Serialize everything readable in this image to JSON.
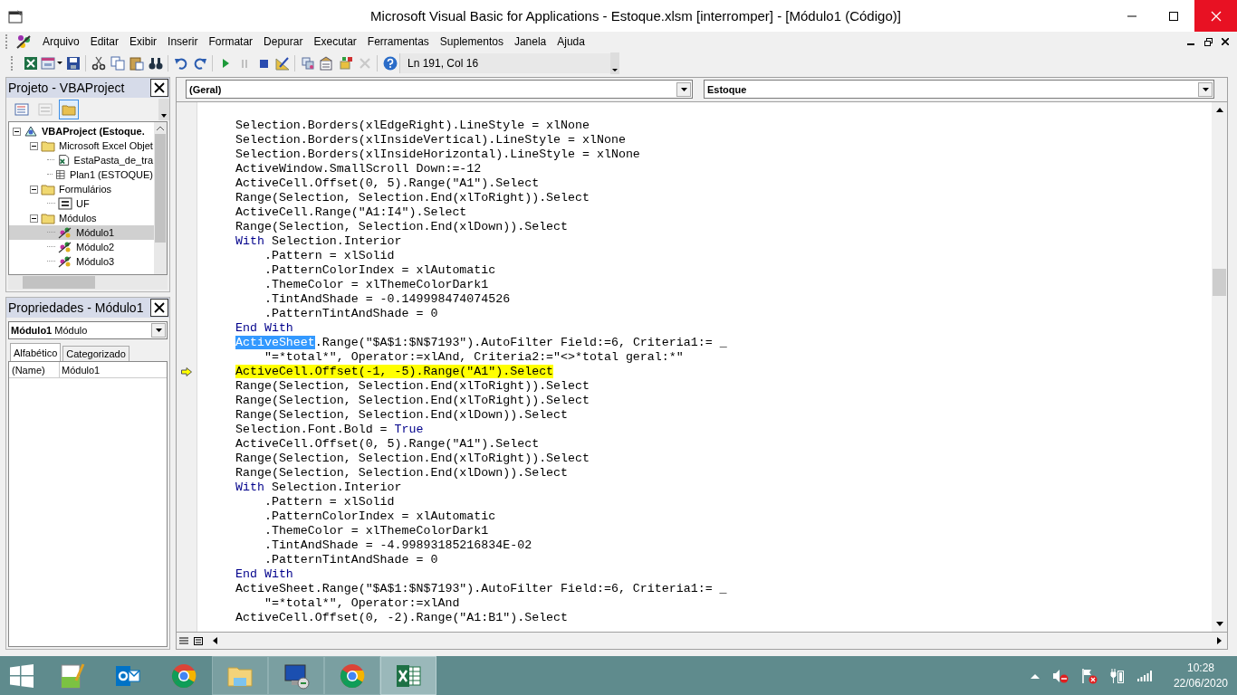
{
  "window": {
    "title": "Microsoft Visual Basic for Applications - Estoque.xlsm [interromper] - [Módulo1 (Código)]"
  },
  "menu": [
    "Arquivo",
    "Editar",
    "Exibir",
    "Inserir",
    "Formatar",
    "Depurar",
    "Executar",
    "Ferramentas",
    "Suplementos",
    "Janela",
    "Ajuda"
  ],
  "toolbar": {
    "buttons": [
      {
        "kind": "excel",
        "disabled": false
      },
      {
        "kind": "insert-form",
        "disabled": false
      },
      {
        "kind": "save",
        "disabled": false
      },
      {
        "kind": "cut",
        "disabled": false
      },
      {
        "kind": "copy",
        "disabled": false
      },
      {
        "kind": "paste",
        "disabled": false
      },
      {
        "kind": "find",
        "disabled": false
      },
      {
        "kind": "undo",
        "disabled": false
      },
      {
        "kind": "redo",
        "disabled": false
      },
      {
        "kind": "run",
        "disabled": false
      },
      {
        "kind": "pause",
        "disabled": true
      },
      {
        "kind": "stop",
        "disabled": false
      },
      {
        "kind": "design",
        "disabled": false
      },
      {
        "kind": "project",
        "disabled": false
      },
      {
        "kind": "properties",
        "disabled": false
      },
      {
        "kind": "browser",
        "disabled": false
      },
      {
        "kind": "toolbox",
        "disabled": true
      },
      {
        "kind": "help",
        "disabled": false
      }
    ],
    "position": "Ln 191, Col 16"
  },
  "project": {
    "title": "Projeto - VBAProject",
    "buttons": [
      {
        "kind": "view-code",
        "disabled": false,
        "selected": false
      },
      {
        "kind": "view-object",
        "disabled": true,
        "selected": false
      },
      {
        "kind": "folders",
        "disabled": false,
        "selected": true
      }
    ],
    "tree": [
      {
        "label": "VBAProject (Estoque.",
        "kind": "project",
        "expanded": true,
        "selected": false,
        "children": [
          {
            "label": "Microsoft Excel Objet",
            "kind": "folder",
            "expanded": true,
            "selected": false,
            "children": [
              {
                "label": "EstaPasta_de_tra",
                "kind": "workbook",
                "selected": false
              },
              {
                "label": "Plan1 (ESTOQUE)",
                "kind": "sheet",
                "selected": false
              }
            ]
          },
          {
            "label": "Formulários",
            "kind": "folder",
            "expanded": true,
            "selected": false,
            "children": [
              {
                "label": "UF",
                "kind": "form",
                "selected": false
              }
            ]
          },
          {
            "label": "Módulos",
            "kind": "folder",
            "expanded": true,
            "selected": false,
            "children": [
              {
                "label": "Módulo1",
                "kind": "module",
                "selected": true
              },
              {
                "label": "Módulo2",
                "kind": "module",
                "selected": false
              },
              {
                "label": "Módulo3",
                "kind": "module",
                "selected": false
              }
            ]
          }
        ]
      }
    ]
  },
  "properties": {
    "title": "Propriedades - Módulo1",
    "object_name": "Módulo1",
    "object_type": "Módulo",
    "tabs": [
      {
        "label": "Alfabético",
        "selected": true
      },
      {
        "label": "Categorizado",
        "selected": false
      }
    ],
    "rows": [
      {
        "name": "(Name)",
        "value": "Módulo1"
      }
    ]
  },
  "code": {
    "object": "(Geral)",
    "procedure": "Estoque",
    "lines": [
      {
        "current": false,
        "segments": [
          {
            "text": "Selection.Borders(xlEdgeRight).LineStyle = xlNone",
            "kind": "plain"
          }
        ]
      },
      {
        "current": false,
        "segments": [
          {
            "text": "Selection.Borders(xlInsideVertical).LineStyle = xlNone",
            "kind": "plain"
          }
        ]
      },
      {
        "current": false,
        "segments": [
          {
            "text": "Selection.Borders(xlInsideHorizontal).LineStyle = xlNone",
            "kind": "plain"
          }
        ]
      },
      {
        "current": false,
        "segments": [
          {
            "text": "ActiveWindow.SmallScroll Down:=-12",
            "kind": "plain"
          }
        ]
      },
      {
        "current": false,
        "segments": [
          {
            "text": "ActiveCell.Offset(0, 5).Range(\"A1\").Select",
            "kind": "plain"
          }
        ]
      },
      {
        "current": false,
        "segments": [
          {
            "text": "Range(Selection, Selection.End(xlToRight)).Select",
            "kind": "plain"
          }
        ]
      },
      {
        "current": false,
        "segments": [
          {
            "text": "ActiveCell.Range(\"A1:I4\").Select",
            "kind": "plain"
          }
        ]
      },
      {
        "current": false,
        "segments": [
          {
            "text": "Range(Selection, Selection.End(xlDown)).Select",
            "kind": "plain"
          }
        ]
      },
      {
        "current": false,
        "segments": [
          {
            "text": "With",
            "kind": "keyword"
          },
          {
            "text": "Selection.Interior",
            "kind": "plain"
          }
        ]
      },
      {
        "current": false,
        "segments": [
          {
            "text": "    .Pattern = xlSolid",
            "kind": "plain"
          }
        ]
      },
      {
        "current": false,
        "segments": [
          {
            "text": "    .PatternColorIndex = xlAutomatic",
            "kind": "plain"
          }
        ]
      },
      {
        "current": false,
        "segments": [
          {
            "text": "    .ThemeColor = xlThemeColorDark1",
            "kind": "plain"
          }
        ]
      },
      {
        "current": false,
        "segments": [
          {
            "text": "    .TintAndShade = -0.149998474074526",
            "kind": "plain"
          }
        ]
      },
      {
        "current": false,
        "segments": [
          {
            "text": "    .PatternTintAndShade = 0",
            "kind": "plain"
          }
        ]
      },
      {
        "current": false,
        "segments": [
          {
            "text": "End With",
            "kind": "keyword"
          }
        ]
      },
      {
        "current": false,
        "segments": [
          {
            "text": "ActiveSheet",
            "kind": "selected"
          },
          {
            "text": ".Range(\"$A$1:$N$7193\").AutoFilter Field:=6, Criteria1:= _",
            "kind": "plain"
          }
        ]
      },
      {
        "current": false,
        "segments": [
          {
            "text": "    \"=*total*\", Operator:=xlAnd, Criteria2:=\"<>*total geral:*\"",
            "kind": "plain"
          }
        ]
      },
      {
        "current": true,
        "segments": [
          {
            "text": "ActiveCell.Offset(-1, -5).Range(\"A1\").Select",
            "kind": "plain"
          }
        ]
      },
      {
        "current": false,
        "segments": [
          {
            "text": "Range(Selection, Selection.End(xlToRight)).Select",
            "kind": "plain"
          }
        ]
      },
      {
        "current": false,
        "segments": [
          {
            "text": "Range(Selection, Selection.End(xlToRight)).Select",
            "kind": "plain"
          }
        ]
      },
      {
        "current": false,
        "segments": [
          {
            "text": "Range(Selection, Selection.End(xlDown)).Select",
            "kind": "plain"
          }
        ]
      },
      {
        "current": false,
        "segments": [
          {
            "text": "Selection.Font.Bold =",
            "kind": "plain"
          },
          {
            "text": "True",
            "kind": "keyword"
          }
        ]
      },
      {
        "current": false,
        "segments": [
          {
            "text": "ActiveCell.Offset(0, 5).Range(\"A1\").Select",
            "kind": "plain"
          }
        ]
      },
      {
        "current": false,
        "segments": [
          {
            "text": "Range(Selection, Selection.End(xlToRight)).Select",
            "kind": "plain"
          }
        ]
      },
      {
        "current": false,
        "segments": [
          {
            "text": "Range(Selection, Selection.End(xlDown)).Select",
            "kind": "plain"
          }
        ]
      },
      {
        "current": false,
        "segments": [
          {
            "text": "With",
            "kind": "keyword"
          },
          {
            "text": "Selection.Interior",
            "kind": "plain"
          }
        ]
      },
      {
        "current": false,
        "segments": [
          {
            "text": "    .Pattern = xlSolid",
            "kind": "plain"
          }
        ]
      },
      {
        "current": false,
        "segments": [
          {
            "text": "    .PatternColorIndex = xlAutomatic",
            "kind": "plain"
          }
        ]
      },
      {
        "current": false,
        "segments": [
          {
            "text": "    .ThemeColor = xlThemeColorDark1",
            "kind": "plain"
          }
        ]
      },
      {
        "current": false,
        "segments": [
          {
            "text": "    .TintAndShade = -4.99893185216834E-02",
            "kind": "plain"
          }
        ]
      },
      {
        "current": false,
        "segments": [
          {
            "text": "    .PatternTintAndShade = 0",
            "kind": "plain"
          }
        ]
      },
      {
        "current": false,
        "segments": [
          {
            "text": "End With",
            "kind": "keyword"
          }
        ]
      },
      {
        "current": false,
        "segments": [
          {
            "text": "ActiveSheet.Range(\"$A$1:$N$7193\").AutoFilter Field:=6, Criteria1:= _",
            "kind": "plain"
          }
        ]
      },
      {
        "current": false,
        "segments": [
          {
            "text": "    \"=*total*\", Operator:=xlAnd",
            "kind": "plain"
          }
        ]
      },
      {
        "current": false,
        "segments": [
          {
            "text": "ActiveCell.Offset(0, -2).Range(\"A1:B1\").Select",
            "kind": "plain"
          }
        ]
      }
    ]
  },
  "taskbar": {
    "apps": [
      {
        "kind": "notepad",
        "running": false,
        "selected": false
      },
      {
        "kind": "outlook",
        "running": false,
        "selected": false
      },
      {
        "kind": "chrome",
        "running": false,
        "selected": false
      },
      {
        "kind": "explorer",
        "running": true,
        "selected": false
      },
      {
        "kind": "remote",
        "running": true,
        "selected": false
      },
      {
        "kind": "chrome",
        "running": true,
        "selected": false
      },
      {
        "kind": "excel",
        "running": true,
        "selected": true
      }
    ],
    "time": "10:28",
    "date": "22/06/2020"
  }
}
